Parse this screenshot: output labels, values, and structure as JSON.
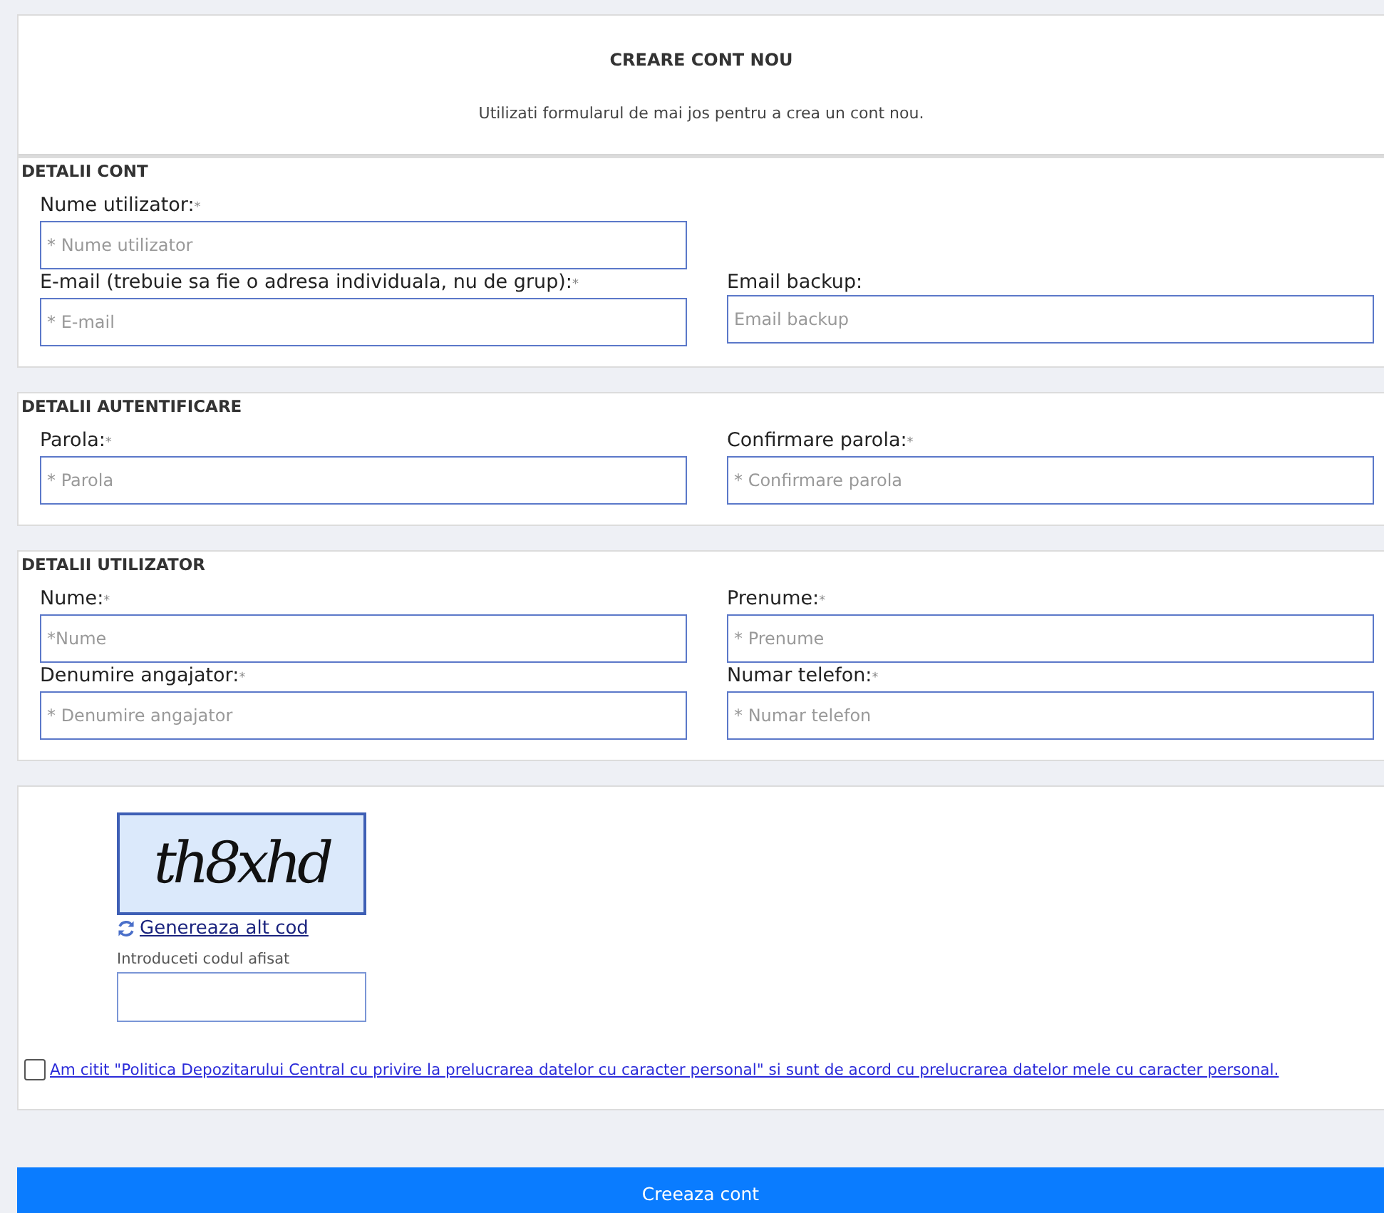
{
  "header": {
    "title": "CREARE CONT NOU",
    "subtitle": "Utilizati formularul de mai jos pentru a crea un cont nou."
  },
  "sections": [
    {
      "title": "DETALII CONT",
      "rows": [
        [
          {
            "label": "Nume utilizator:",
            "mark": "*",
            "placeholder": "* Nume utilizator"
          }
        ],
        [
          {
            "label": "E-mail (trebuie sa fie o adresa individuala, nu de grup):",
            "mark": "*",
            "placeholder": "* E-mail"
          },
          {
            "label": "Email backup:",
            "placeholder": "Email backup"
          }
        ]
      ]
    },
    {
      "title": "DETALII AUTENTIFICARE",
      "rows": [
        [
          {
            "label": "Parola:",
            "mark": "*",
            "placeholder": "* Parola"
          },
          {
            "label": "Confirmare parola:",
            "mark": "*",
            "placeholder": "* Confirmare parola"
          }
        ]
      ]
    },
    {
      "title": "DETALII UTILIZATOR",
      "rows": [
        [
          {
            "label": "Nume:",
            "mark": "*",
            "placeholder": "*Nume"
          },
          {
            "label": "Prenume:",
            "mark": "*",
            "placeholder": "* Prenume"
          }
        ],
        [
          {
            "label": "Denumire angajator:",
            "mark": "*",
            "placeholder": "* Denumire angajator"
          },
          {
            "label": "Numar telefon:",
            "mark": "*",
            "placeholder": "* Numar telefon"
          }
        ]
      ]
    }
  ],
  "captcha": {
    "code": "th8xhd",
    "refresh_link": "Genereaza alt cod",
    "input_label": "Introduceti codul afisat"
  },
  "consent": {
    "checked": false,
    "text": " Am citit \"Politica Depozitarului Central cu privire la prelucrarea datelor cu caracter personal\" si sunt de acord cu prelucrarea datelor mele cu caracter personal."
  },
  "submit": "Creeaza cont"
}
